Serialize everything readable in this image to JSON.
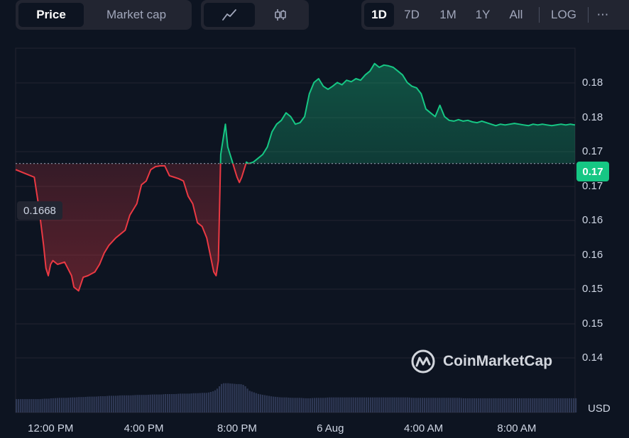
{
  "toolbar": {
    "metric_tabs": [
      {
        "label": "Price",
        "active": true
      },
      {
        "label": "Market cap",
        "active": false
      }
    ],
    "chart_type_icons": [
      "line-chart-icon",
      "candlestick-icon"
    ],
    "ranges": [
      {
        "label": "1D",
        "active": true
      },
      {
        "label": "7D",
        "active": false
      },
      {
        "label": "1M",
        "active": false
      },
      {
        "label": "1Y",
        "active": false
      },
      {
        "label": "All",
        "active": false
      }
    ],
    "log_label": "LOG",
    "more_label": "⋯"
  },
  "reference_price": "0.1668",
  "current_price": "0.17",
  "currency_label": "USD",
  "watermark_text": "CoinMarketCap",
  "colors": {
    "background": "#0d1421",
    "up": "#16c784",
    "down": "#ea3943",
    "grid": "#222531"
  },
  "chart_data": {
    "type": "area",
    "y_tick_labels": [
      "0.18",
      "0.18",
      "0.17",
      "0.17",
      "0.16",
      "0.16",
      "0.15",
      "0.15",
      "0.14"
    ],
    "x_tick_labels": [
      "12:00 PM",
      "4:00 PM",
      "8:00 PM",
      "6 Aug",
      "4:00 AM",
      "8:00 AM"
    ],
    "ylim": [
      0.1405,
      0.1795
    ],
    "baseline": 0.1668,
    "x_hours": [
      0,
      0.4,
      0.8,
      1.0,
      1.2,
      1.3,
      1.4,
      1.5,
      1.6,
      1.8,
      2.1,
      2.4,
      2.5,
      2.7,
      2.9,
      3.1,
      3.4,
      3.6,
      3.8,
      4.0,
      4.3,
      4.5,
      4.7,
      4.9,
      5.2,
      5.4,
      5.6,
      5.8,
      6.0,
      6.2,
      6.4,
      6.6,
      6.8,
      7.0,
      7.2,
      7.4,
      7.6,
      7.8,
      8.0,
      8.2,
      8.4,
      8.5,
      8.6,
      8.7,
      8.8,
      8.9,
      9.0,
      9.1,
      9.2,
      9.3,
      9.4,
      9.5,
      9.6,
      9.7,
      9.8,
      9.9,
      10.0,
      10.2,
      10.4,
      10.6,
      10.8,
      11.0,
      11.2,
      11.4,
      11.6,
      11.8,
      12.0,
      12.2,
      12.4,
      12.6,
      12.8,
      13.0,
      13.2,
      13.4,
      13.6,
      13.8,
      14.0,
      14.2,
      14.4,
      14.6,
      14.8,
      15.0,
      15.2,
      15.4,
      15.6,
      15.8,
      16.0,
      16.2,
      16.4,
      16.6,
      16.8,
      17.0,
      17.2,
      17.4,
      17.6,
      17.8,
      18.0,
      18.2,
      18.4,
      18.6,
      18.8,
      19.0,
      19.2,
      19.4,
      19.6,
      19.8,
      20.0,
      20.2,
      20.4,
      20.6,
      20.8,
      21.0,
      21.2,
      21.4,
      21.6,
      21.8,
      22.0,
      22.2,
      22.4,
      22.6,
      22.8,
      23.0,
      23.2,
      23.4,
      23.6,
      23.8,
      24.0
    ],
    "price": [
      0.166,
      0.1655,
      0.165,
      0.161,
      0.156,
      0.153,
      0.152,
      0.1535,
      0.154,
      0.1535,
      0.1538,
      0.152,
      0.1505,
      0.15,
      0.1518,
      0.152,
      0.1525,
      0.1535,
      0.155,
      0.156,
      0.157,
      0.1575,
      0.158,
      0.16,
      0.1615,
      0.164,
      0.1645,
      0.166,
      0.1664,
      0.1665,
      0.1665,
      0.1652,
      0.165,
      0.1648,
      0.1645,
      0.1625,
      0.1615,
      0.159,
      0.1585,
      0.157,
      0.154,
      0.1525,
      0.152,
      0.154,
      0.168,
      0.17,
      0.172,
      0.169,
      0.168,
      0.167,
      0.166,
      0.165,
      0.1643,
      0.165,
      0.166,
      0.167,
      0.1668,
      0.167,
      0.1675,
      0.168,
      0.169,
      0.171,
      0.172,
      0.1725,
      0.1735,
      0.173,
      0.172,
      0.1722,
      0.173,
      0.176,
      0.1775,
      0.178,
      0.177,
      0.1766,
      0.177,
      0.1775,
      0.1772,
      0.1778,
      0.1776,
      0.178,
      0.1778,
      0.1785,
      0.179,
      0.18,
      0.1795,
      0.1798,
      0.1797,
      0.1795,
      0.179,
      0.1785,
      0.1775,
      0.177,
      0.1768,
      0.176,
      0.174,
      0.1735,
      0.173,
      0.1745,
      0.173,
      0.1725,
      0.1724,
      0.1726,
      0.1724,
      0.1725,
      0.1723,
      0.1722,
      0.1724,
      0.1722,
      0.172,
      0.1718,
      0.172,
      0.1719,
      0.172,
      0.1721,
      0.172,
      0.1719,
      0.1718,
      0.172,
      0.1719,
      0.172,
      0.1719,
      0.1718,
      0.1719,
      0.172,
      0.1719,
      0.172,
      0.1719,
      0.172,
      0.1719
    ],
    "volume": [
      0.32,
      0.32,
      0.32,
      0.32,
      0.33,
      0.33,
      0.33,
      0.34,
      0.34,
      0.35,
      0.35,
      0.36,
      0.36,
      0.37,
      0.37,
      0.38,
      0.38,
      0.39,
      0.39,
      0.4,
      0.4,
      0.41,
      0.41,
      0.41,
      0.42,
      0.42,
      0.42,
      0.43,
      0.43,
      0.43,
      0.44,
      0.44,
      0.44,
      0.45,
      0.45,
      0.45,
      0.46,
      0.46,
      0.47,
      0.47,
      0.5,
      0.52,
      0.56,
      0.62,
      0.68,
      0.7,
      0.7,
      0.7,
      0.69,
      0.69,
      0.68,
      0.68,
      0.68,
      0.67,
      0.64,
      0.58,
      0.52,
      0.48,
      0.44,
      0.42,
      0.4,
      0.38,
      0.37,
      0.36,
      0.36,
      0.35,
      0.35,
      0.35,
      0.34,
      0.34,
      0.35,
      0.35,
      0.35,
      0.36,
      0.36,
      0.36,
      0.36,
      0.36,
      0.36,
      0.36,
      0.36,
      0.36,
      0.36,
      0.36,
      0.36,
      0.36,
      0.36,
      0.36,
      0.36,
      0.36,
      0.36,
      0.35,
      0.35,
      0.35,
      0.35,
      0.35,
      0.35,
      0.35,
      0.35,
      0.35,
      0.35,
      0.35,
      0.34,
      0.34,
      0.34,
      0.34,
      0.34,
      0.34,
      0.34,
      0.34,
      0.34,
      0.34,
      0.34,
      0.34,
      0.34,
      0.34,
      0.34,
      0.34,
      0.34,
      0.34,
      0.34,
      0.34,
      0.34,
      0.34,
      0.34,
      0.34,
      0.34,
      0.34,
      0.34,
      0.3
    ],
    "x_tick_hours": [
      1.5,
      5.5,
      9.5,
      13.5,
      17.5,
      21.5
    ],
    "grid": true,
    "legend": "none"
  }
}
